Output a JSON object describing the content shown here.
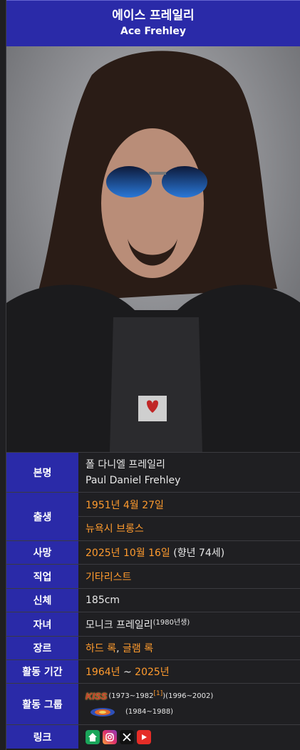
{
  "header": {
    "name_ko": "에이스 프레일리",
    "name_en": "Ace Frehley"
  },
  "rows": {
    "birth_name": {
      "label": "본명",
      "line1": "폴 다니엘 프레일리",
      "line2": "Paul Daniel Frehley"
    },
    "born": {
      "label": "출생",
      "date": "1951년 4월 27일",
      "place": "뉴욕시 브롱스"
    },
    "died": {
      "label": "사망",
      "date": "2025년 10월 16일",
      "age": " (향년 74세)"
    },
    "occupation": {
      "label": "직업",
      "value": "기타리스트"
    },
    "body": {
      "label": "신체",
      "value": "185cm"
    },
    "children": {
      "label": "자녀",
      "value": "모니크 프레일리",
      "note": "(1980년생)"
    },
    "genre": {
      "label": "장르",
      "g1": "하드 록",
      "sep": ", ",
      "g2": "글램 록"
    },
    "active": {
      "label": "활동 기간",
      "start": "1964년",
      "sep": " ~ ",
      "end": "2025년"
    },
    "groups": {
      "label": "활동 그룹",
      "kiss_logo": "KISS",
      "kiss_years_a": "(1973~1982",
      "kiss_ref": "[1]",
      "kiss_years_b": ")(1996~2002)",
      "comet_years": "(1984~1988)"
    },
    "links": {
      "label": "링크"
    }
  },
  "colors": {
    "header_bg": "#2a2aa8",
    "link_orange": "#ff9b2e",
    "row_bg": "#1f1f22"
  },
  "icons": [
    "home-icon",
    "instagram-icon",
    "x-icon",
    "youtube-icon"
  ]
}
